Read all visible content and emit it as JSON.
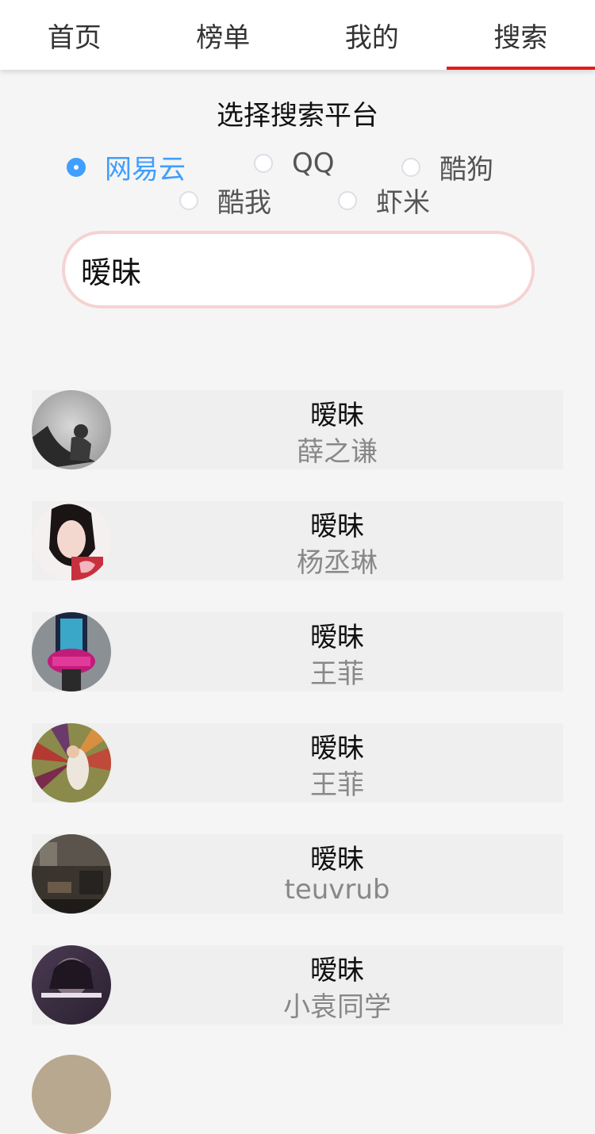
{
  "tabs": [
    {
      "label": "首页",
      "active": false
    },
    {
      "label": "榜单",
      "active": false
    },
    {
      "label": "我的",
      "active": false
    },
    {
      "label": "搜索",
      "active": true
    }
  ],
  "platform": {
    "title": "选择搜索平台",
    "options": [
      {
        "label": "网易云",
        "checked": true
      },
      {
        "label": "QQ",
        "checked": false
      },
      {
        "label": "酷狗",
        "checked": false
      },
      {
        "label": "酷我",
        "checked": false
      },
      {
        "label": "虾米",
        "checked": false
      }
    ]
  },
  "search": {
    "value": "暧昧"
  },
  "results": [
    {
      "song": "暧昧",
      "artist": "薛之谦"
    },
    {
      "song": "暧昧",
      "artist": "杨丞琳"
    },
    {
      "song": "暧昧",
      "artist": "王菲"
    },
    {
      "song": "暧昧",
      "artist": "王菲"
    },
    {
      "song": "暧昧",
      "artist": "teuvrub"
    },
    {
      "song": "暧昧",
      "artist": "小袁同学"
    }
  ],
  "colors": {
    "accent": "#409eff",
    "tab_indicator": "#e51b1b",
    "search_border": "#f6d3d3"
  }
}
